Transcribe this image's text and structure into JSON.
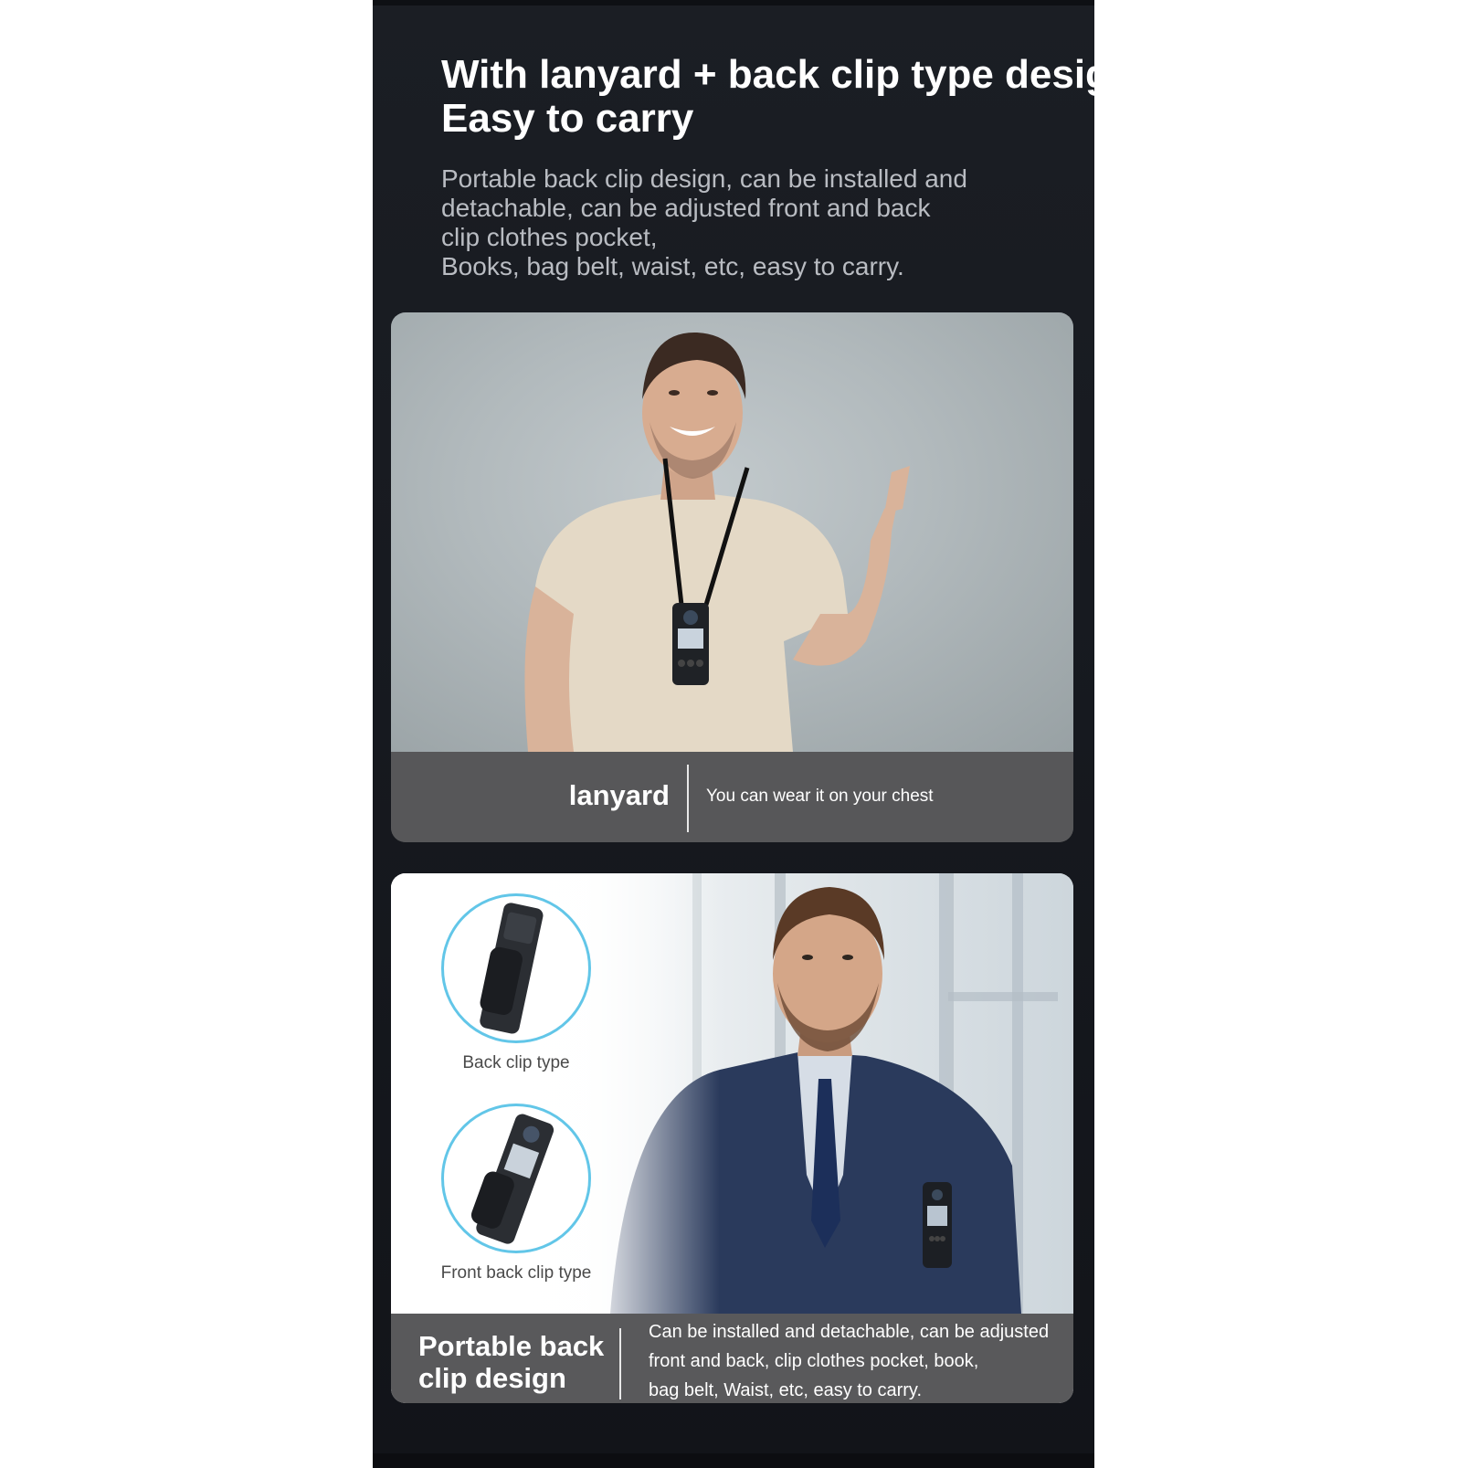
{
  "headline": {
    "line1": "With lanyard + back clip type design",
    "line2": "Easy to carry"
  },
  "description": {
    "line1": "Portable back clip design, can be installed and",
    "line2": "detachable, can be adjusted front and back",
    "line3": "clip clothes pocket,",
    "line4": "Books, bag belt, waist, etc, easy to carry."
  },
  "lanyard_card": {
    "title": "lanyard",
    "text": "You can wear it on your chest"
  },
  "clip_card": {
    "back_clip_label": "Back clip type",
    "front_back_clip_label": "Front back clip type",
    "title_line1": "Portable back",
    "title_line2": "clip design",
    "text_line1": "Can be installed and detachable, can be adjusted",
    "text_line2": "front and back, clip clothes pocket, book,",
    "text_line3": "bag belt,  Waist, etc, easy to carry."
  },
  "colors": {
    "panel_background": "#1b1e24",
    "caption_bar": "#575759",
    "circle_ring": "#62c6e8"
  }
}
